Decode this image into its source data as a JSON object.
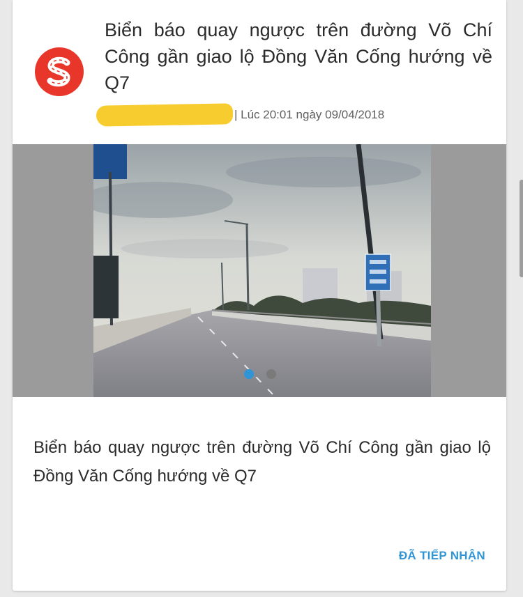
{
  "article": {
    "title": "Biển báo quay ngược trên đường Võ Chí Công gần giao lộ Đồng Văn Cống hướng về Q7",
    "meta": "| Lúc 20:01 ngày 09/04/2018",
    "caption": "Biển báo quay ngược trên đường Võ Chí Công gần giao lộ Đồng Văn Cống hướng về Q7"
  },
  "logo": {
    "icon": "s-road-logo-icon",
    "color": "#e8372a"
  },
  "carousel": {
    "slide_count": 2,
    "active_index": 0,
    "active_color": "#2f95d6",
    "inactive_color": "#7a7a7a"
  },
  "actions": {
    "acknowledged_label": "ĐÃ TIẾP NHẬN",
    "color": "#2f95d6"
  }
}
